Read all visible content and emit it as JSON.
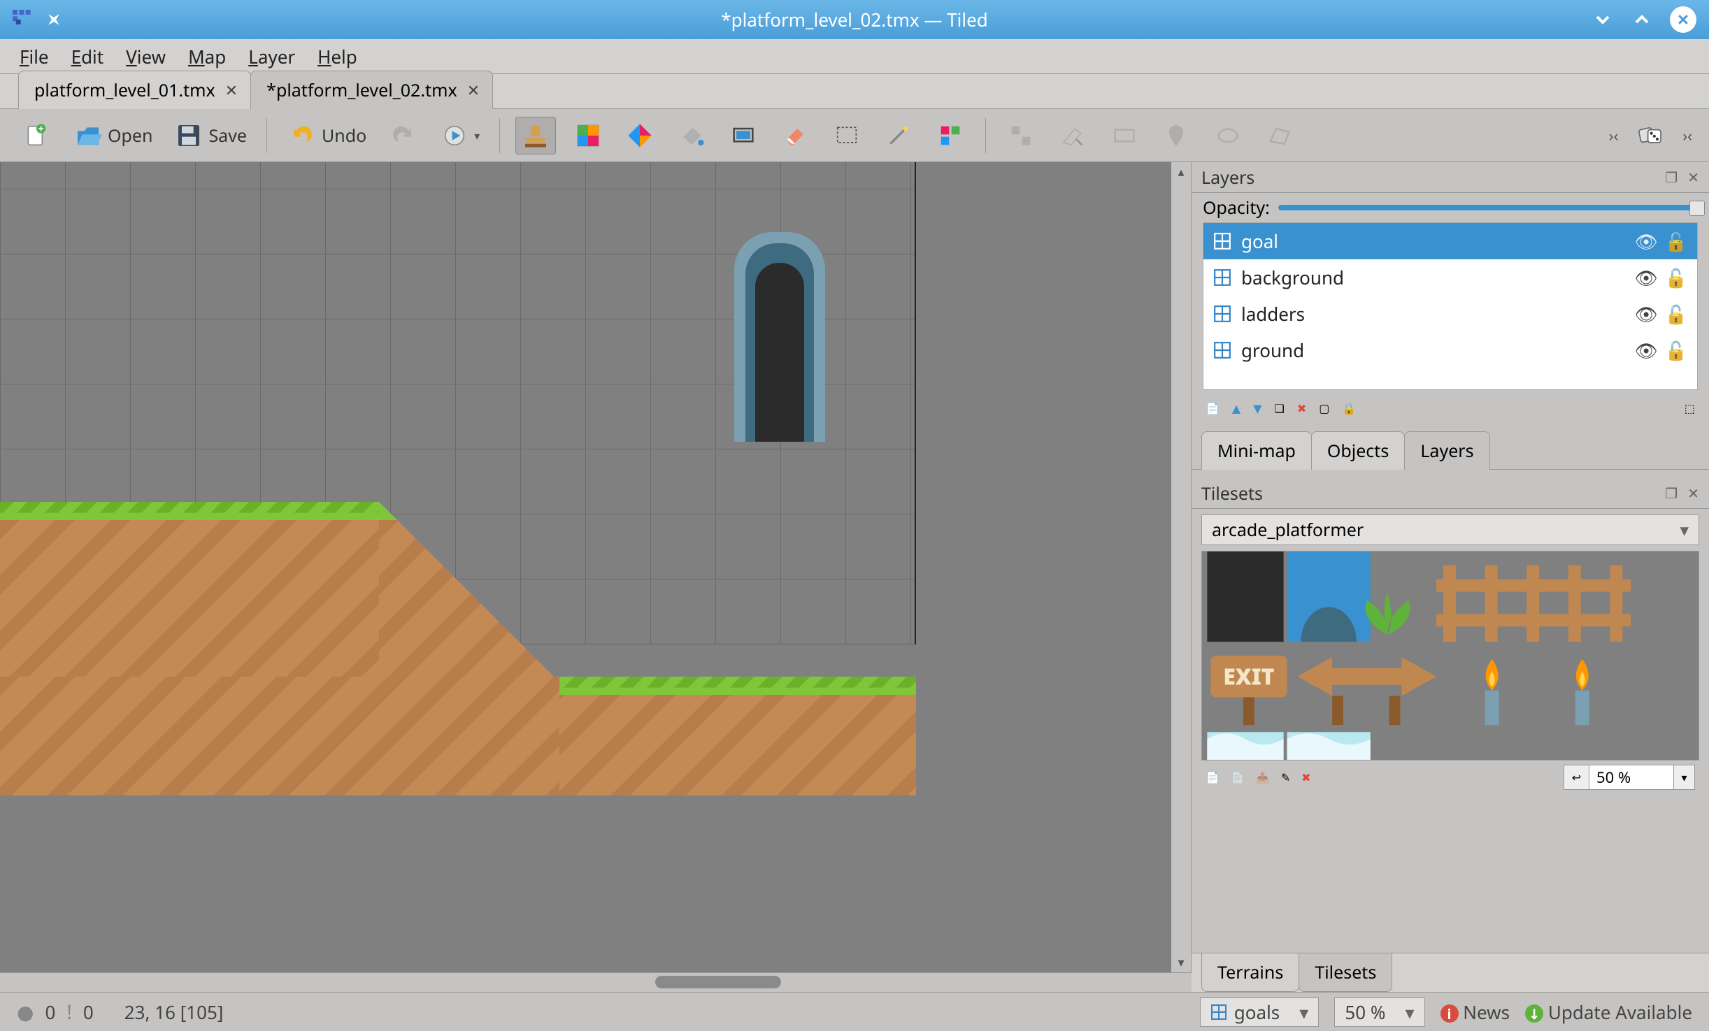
{
  "titlebar": {
    "title": "*platform_level_02.tmx — Tiled"
  },
  "menu": {
    "items": [
      "File",
      "Edit",
      "View",
      "Map",
      "Layer",
      "Help"
    ]
  },
  "file_tabs": {
    "tabs": [
      {
        "label": "platform_level_01.tmx",
        "active": false
      },
      {
        "label": "*platform_level_02.tmx",
        "active": true
      }
    ]
  },
  "toolbar": {
    "open": "Open",
    "save": "Save",
    "undo": "Undo"
  },
  "layers_panel": {
    "title": "Layers",
    "opacity_label": "Opacity:",
    "items": [
      {
        "name": "goal",
        "selected": true
      },
      {
        "name": "background",
        "selected": false
      },
      {
        "name": "ladders",
        "selected": false
      },
      {
        "name": "ground",
        "selected": false
      }
    ],
    "subtabs": [
      "Mini-map",
      "Objects",
      "Layers"
    ],
    "subtab_active": 2
  },
  "tilesets_panel": {
    "title": "Tilesets",
    "selected": "arcade_platformer",
    "zoom": "50 %",
    "subtabs": [
      "Terrains",
      "Tilesets"
    ],
    "subtab_active": 1
  },
  "statusbar": {
    "errors": "0",
    "warnings": "0",
    "coords": "23, 16 [105]",
    "layer_combo": "goals",
    "zoom": "50 %",
    "news": "News",
    "update": "Update Available"
  }
}
